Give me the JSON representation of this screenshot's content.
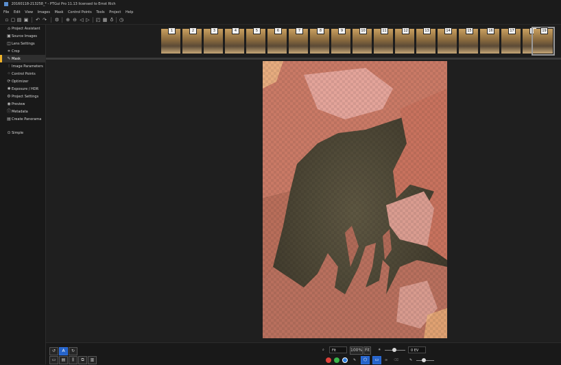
{
  "titlebar": {
    "title": "20160118-213258_* - PTGui Pro 11.13 licensed to Ernst Rich"
  },
  "menubar": {
    "items": [
      "File",
      "Edit",
      "View",
      "Images",
      "Mask",
      "Control Points",
      "Tools",
      "Project",
      "Help"
    ]
  },
  "toolbar": {
    "icons": [
      "new-file-icon",
      "open-file-icon",
      "save-icon",
      "save-as-icon",
      "undo-icon",
      "redo-icon",
      "settings-icon",
      "zoom-in-icon",
      "zoom-out-icon",
      "previous-icon",
      "next-icon",
      "layout-icon",
      "grid-icon",
      "pin-icon",
      "history-icon"
    ]
  },
  "sidebar": {
    "items": [
      {
        "label": "Project Assistant",
        "icon": "home-icon",
        "glyph": "⌂"
      },
      {
        "label": "Source Images",
        "icon": "images-icon",
        "glyph": "▣"
      },
      {
        "label": "Lens Settings",
        "icon": "lens-icon",
        "glyph": "◫"
      },
      {
        "label": "Crop",
        "icon": "crop-icon",
        "glyph": "⌗"
      },
      {
        "label": "Mask",
        "icon": "brush-icon",
        "glyph": "✎",
        "active": true
      },
      {
        "label": "Image Parameters",
        "icon": "sliders-icon",
        "glyph": "⫶"
      },
      {
        "label": "Control Points",
        "icon": "control-points-icon",
        "glyph": "⁘"
      },
      {
        "label": "Optimizer",
        "icon": "optimizer-icon",
        "glyph": "⟳"
      },
      {
        "label": "Exposure / HDR",
        "icon": "exposure-icon",
        "glyph": "✺"
      },
      {
        "label": "Project Settings",
        "icon": "gear-icon",
        "glyph": "⚙"
      },
      {
        "label": "Preview",
        "icon": "eye-icon",
        "glyph": "◉"
      },
      {
        "label": "Metadata",
        "icon": "info-icon",
        "glyph": "ⓘ"
      },
      {
        "label": "Create Panorama",
        "icon": "panorama-icon",
        "glyph": "▤"
      },
      {
        "label": "Simple",
        "icon": "simple-mode-icon",
        "glyph": "⊙"
      }
    ]
  },
  "thumbnails": [
    "1",
    "2",
    "3",
    "4",
    "5",
    "6",
    "7",
    "8",
    "9",
    "10",
    "11",
    "12",
    "13",
    "14",
    "15",
    "16",
    "17",
    "18",
    "19"
  ],
  "selected_thumbnail": "19",
  "bottombar": {
    "zoom_value": "Fit",
    "zoom_100": "100%",
    "zoom_fit": "Fit",
    "exposure_value": "0 EV",
    "mask_colors": {
      "red": "#e0413a",
      "green": "#3ab54a",
      "white": "#ffffff"
    },
    "accent": "#2563c9"
  }
}
